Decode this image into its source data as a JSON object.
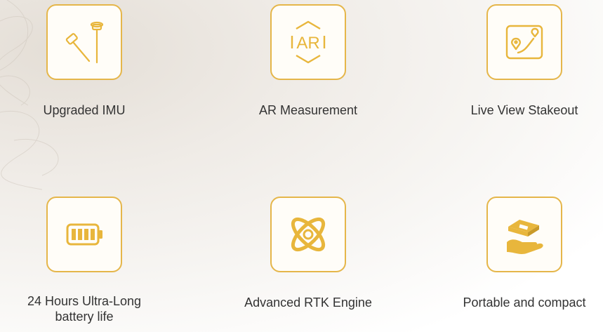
{
  "colors": {
    "accent": "#e5b64a",
    "icon_fill": "#e8b63c",
    "text": "#333333"
  },
  "features": [
    {
      "icon": "survey-pole-imu-icon",
      "label": "Upgraded IMU"
    },
    {
      "icon": "ar-measurement-icon",
      "label": "AR Measurement"
    },
    {
      "icon": "map-stakeout-icon",
      "label": "Live View Stakeout"
    },
    {
      "icon": "battery-icon",
      "label_line1": "24 Hours Ultra-Long",
      "label_line2": "battery life"
    },
    {
      "icon": "atom-rtk-icon",
      "label": "Advanced RTK Engine"
    },
    {
      "icon": "hand-device-icon",
      "label": "Portable and compact"
    }
  ]
}
